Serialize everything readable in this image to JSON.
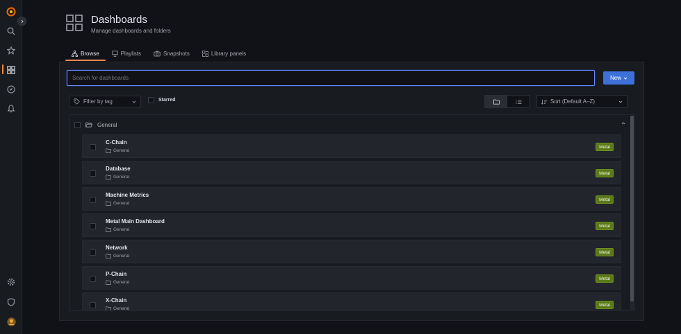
{
  "sidebar": {
    "items": [
      {
        "name": "grafana-logo",
        "label": "Grafana"
      },
      {
        "name": "search-icon",
        "label": "Search"
      },
      {
        "name": "star-icon",
        "label": "Starred"
      },
      {
        "name": "dashboards-icon",
        "label": "Dashboards"
      },
      {
        "name": "explore-icon",
        "label": "Explore"
      },
      {
        "name": "alerting-icon",
        "label": "Alerting"
      },
      {
        "name": "gear-icon",
        "label": "Configuration"
      },
      {
        "name": "shield-icon",
        "label": "Server Admin"
      },
      {
        "name": "avatar",
        "label": "Profile"
      }
    ],
    "active": "Dashboards",
    "accent": "#ff8833"
  },
  "header": {
    "title": "Dashboards",
    "subtitle": "Manage dashboards and folders"
  },
  "tabs": [
    {
      "label": "Browse",
      "icon": "sitemap-icon",
      "active": true
    },
    {
      "label": "Playlists",
      "icon": "presentation-icon",
      "active": false
    },
    {
      "label": "Snapshots",
      "icon": "camera-icon",
      "active": false
    },
    {
      "label": "Library panels",
      "icon": "library-panels-icon",
      "active": false
    }
  ],
  "search": {
    "placeholder": "Search for dashboards",
    "value": ""
  },
  "new_button": {
    "label": "New",
    "color": "#3d71d9"
  },
  "filters": {
    "tag_placeholder": "Filter by tag",
    "starred_label": "Starred",
    "sort_label": "Sort (Default A–Z)",
    "view": "folders"
  },
  "folder": {
    "name": "General",
    "expanded": true
  },
  "dashboards": [
    {
      "title": "C-Chain",
      "folder": "General",
      "tag": "Metal"
    },
    {
      "title": "Database",
      "folder": "General",
      "tag": "Metal"
    },
    {
      "title": "Machine Metrics",
      "folder": "General",
      "tag": "Metal"
    },
    {
      "title": "Metal Main Dashboard",
      "folder": "General",
      "tag": "Metal"
    },
    {
      "title": "Network",
      "folder": "General",
      "tag": "Metal"
    },
    {
      "title": "P-Chain",
      "folder": "General",
      "tag": "Metal"
    },
    {
      "title": "X-Chain",
      "folder": "General",
      "tag": "Metal"
    }
  ],
  "colors": {
    "tag": "#5c7a1a",
    "tab_underline": "#f58a52",
    "background": "#111217"
  }
}
